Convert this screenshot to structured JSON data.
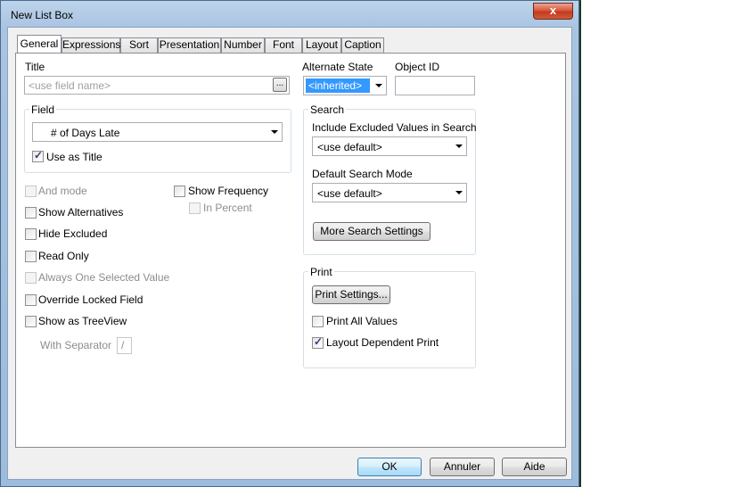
{
  "window": {
    "title": "New List Box",
    "close_glyph": "x"
  },
  "tabs": [
    {
      "label": "General",
      "active": true
    },
    {
      "label": "Expressions"
    },
    {
      "label": "Sort"
    },
    {
      "label": "Presentation"
    },
    {
      "label": "Number"
    },
    {
      "label": "Font"
    },
    {
      "label": "Layout"
    },
    {
      "label": "Caption"
    }
  ],
  "title_section": {
    "label": "Title",
    "placeholder": "<use field name>",
    "ellipsis": "..."
  },
  "alternate_state": {
    "label": "Alternate State",
    "value": "<inherited>"
  },
  "object_id": {
    "label": "Object ID",
    "value": ""
  },
  "field_group": {
    "label": "Field",
    "value": "# of Days Late",
    "use_as_title": {
      "label": "Use as Title",
      "checked": true
    }
  },
  "options": {
    "and_mode": {
      "label": "And mode",
      "checked": false,
      "enabled": false
    },
    "show_frequency": {
      "label": "Show Frequency",
      "checked": false
    },
    "in_percent": {
      "label": "In Percent",
      "checked": false,
      "enabled": false
    },
    "show_alternatives": {
      "label": "Show Alternatives",
      "checked": false
    },
    "hide_excluded": {
      "label": "Hide Excluded",
      "checked": false
    },
    "read_only": {
      "label": "Read Only",
      "checked": false
    },
    "always_one_selected": {
      "label": "Always One Selected Value",
      "checked": false,
      "enabled": false
    },
    "override_locked": {
      "label": "Override Locked Field",
      "checked": false
    },
    "show_as_treeview": {
      "label": "Show as TreeView",
      "checked": false
    },
    "with_separator": {
      "label": "With Separator",
      "value": "/",
      "enabled": false
    }
  },
  "search_group": {
    "label": "Search",
    "include_excluded_label": "Include Excluded Values in Search",
    "include_excluded_value": "<use default>",
    "default_mode_label": "Default Search Mode",
    "default_mode_value": "<use default>",
    "more_button": "More Search Settings"
  },
  "print_group": {
    "label": "Print",
    "settings_button": "Print Settings...",
    "print_all": {
      "label": "Print All Values",
      "checked": false
    },
    "layout_dependent": {
      "label": "Layout Dependent Print",
      "checked": true
    }
  },
  "footer": {
    "ok": "OK",
    "cancel": "Annuler",
    "help": "Aide"
  },
  "colors": {
    "selection": "#3399ff",
    "check": "#3a3a7a"
  }
}
